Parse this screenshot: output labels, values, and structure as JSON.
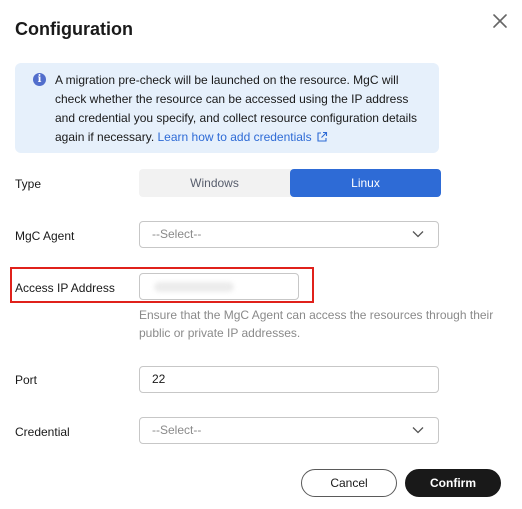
{
  "dialog": {
    "title": "Configuration",
    "close_icon": "close-icon"
  },
  "notice": {
    "icon": "info-icon",
    "text": "A migration pre-check will be launched on the resource. MgC will check whether the resource can be accessed using the IP address and credential you specify, and collect resource configuration details again if necessary. ",
    "link": "Learn how to add credentials",
    "link_icon": "external-link-icon"
  },
  "form": {
    "type": {
      "label": "Type",
      "options": [
        "Windows",
        "Linux"
      ],
      "selected": "Linux"
    },
    "agent": {
      "label": "MgC Agent",
      "placeholder": "--Select--"
    },
    "ip": {
      "label": "Access IP Address",
      "hint": "Ensure that the MgC Agent can access the resources through their public or private IP addresses."
    },
    "port": {
      "label": "Port",
      "value": "22"
    },
    "credential": {
      "label": "Credential",
      "placeholder": "--Select--"
    }
  },
  "footer": {
    "cancel_label": "Cancel",
    "confirm_label": "Confirm"
  },
  "colors": {
    "accent": "#2e6bd6",
    "notice_bg": "#e6f0fb",
    "highlight": "#e0211b",
    "confirm_bg": "#191919"
  }
}
